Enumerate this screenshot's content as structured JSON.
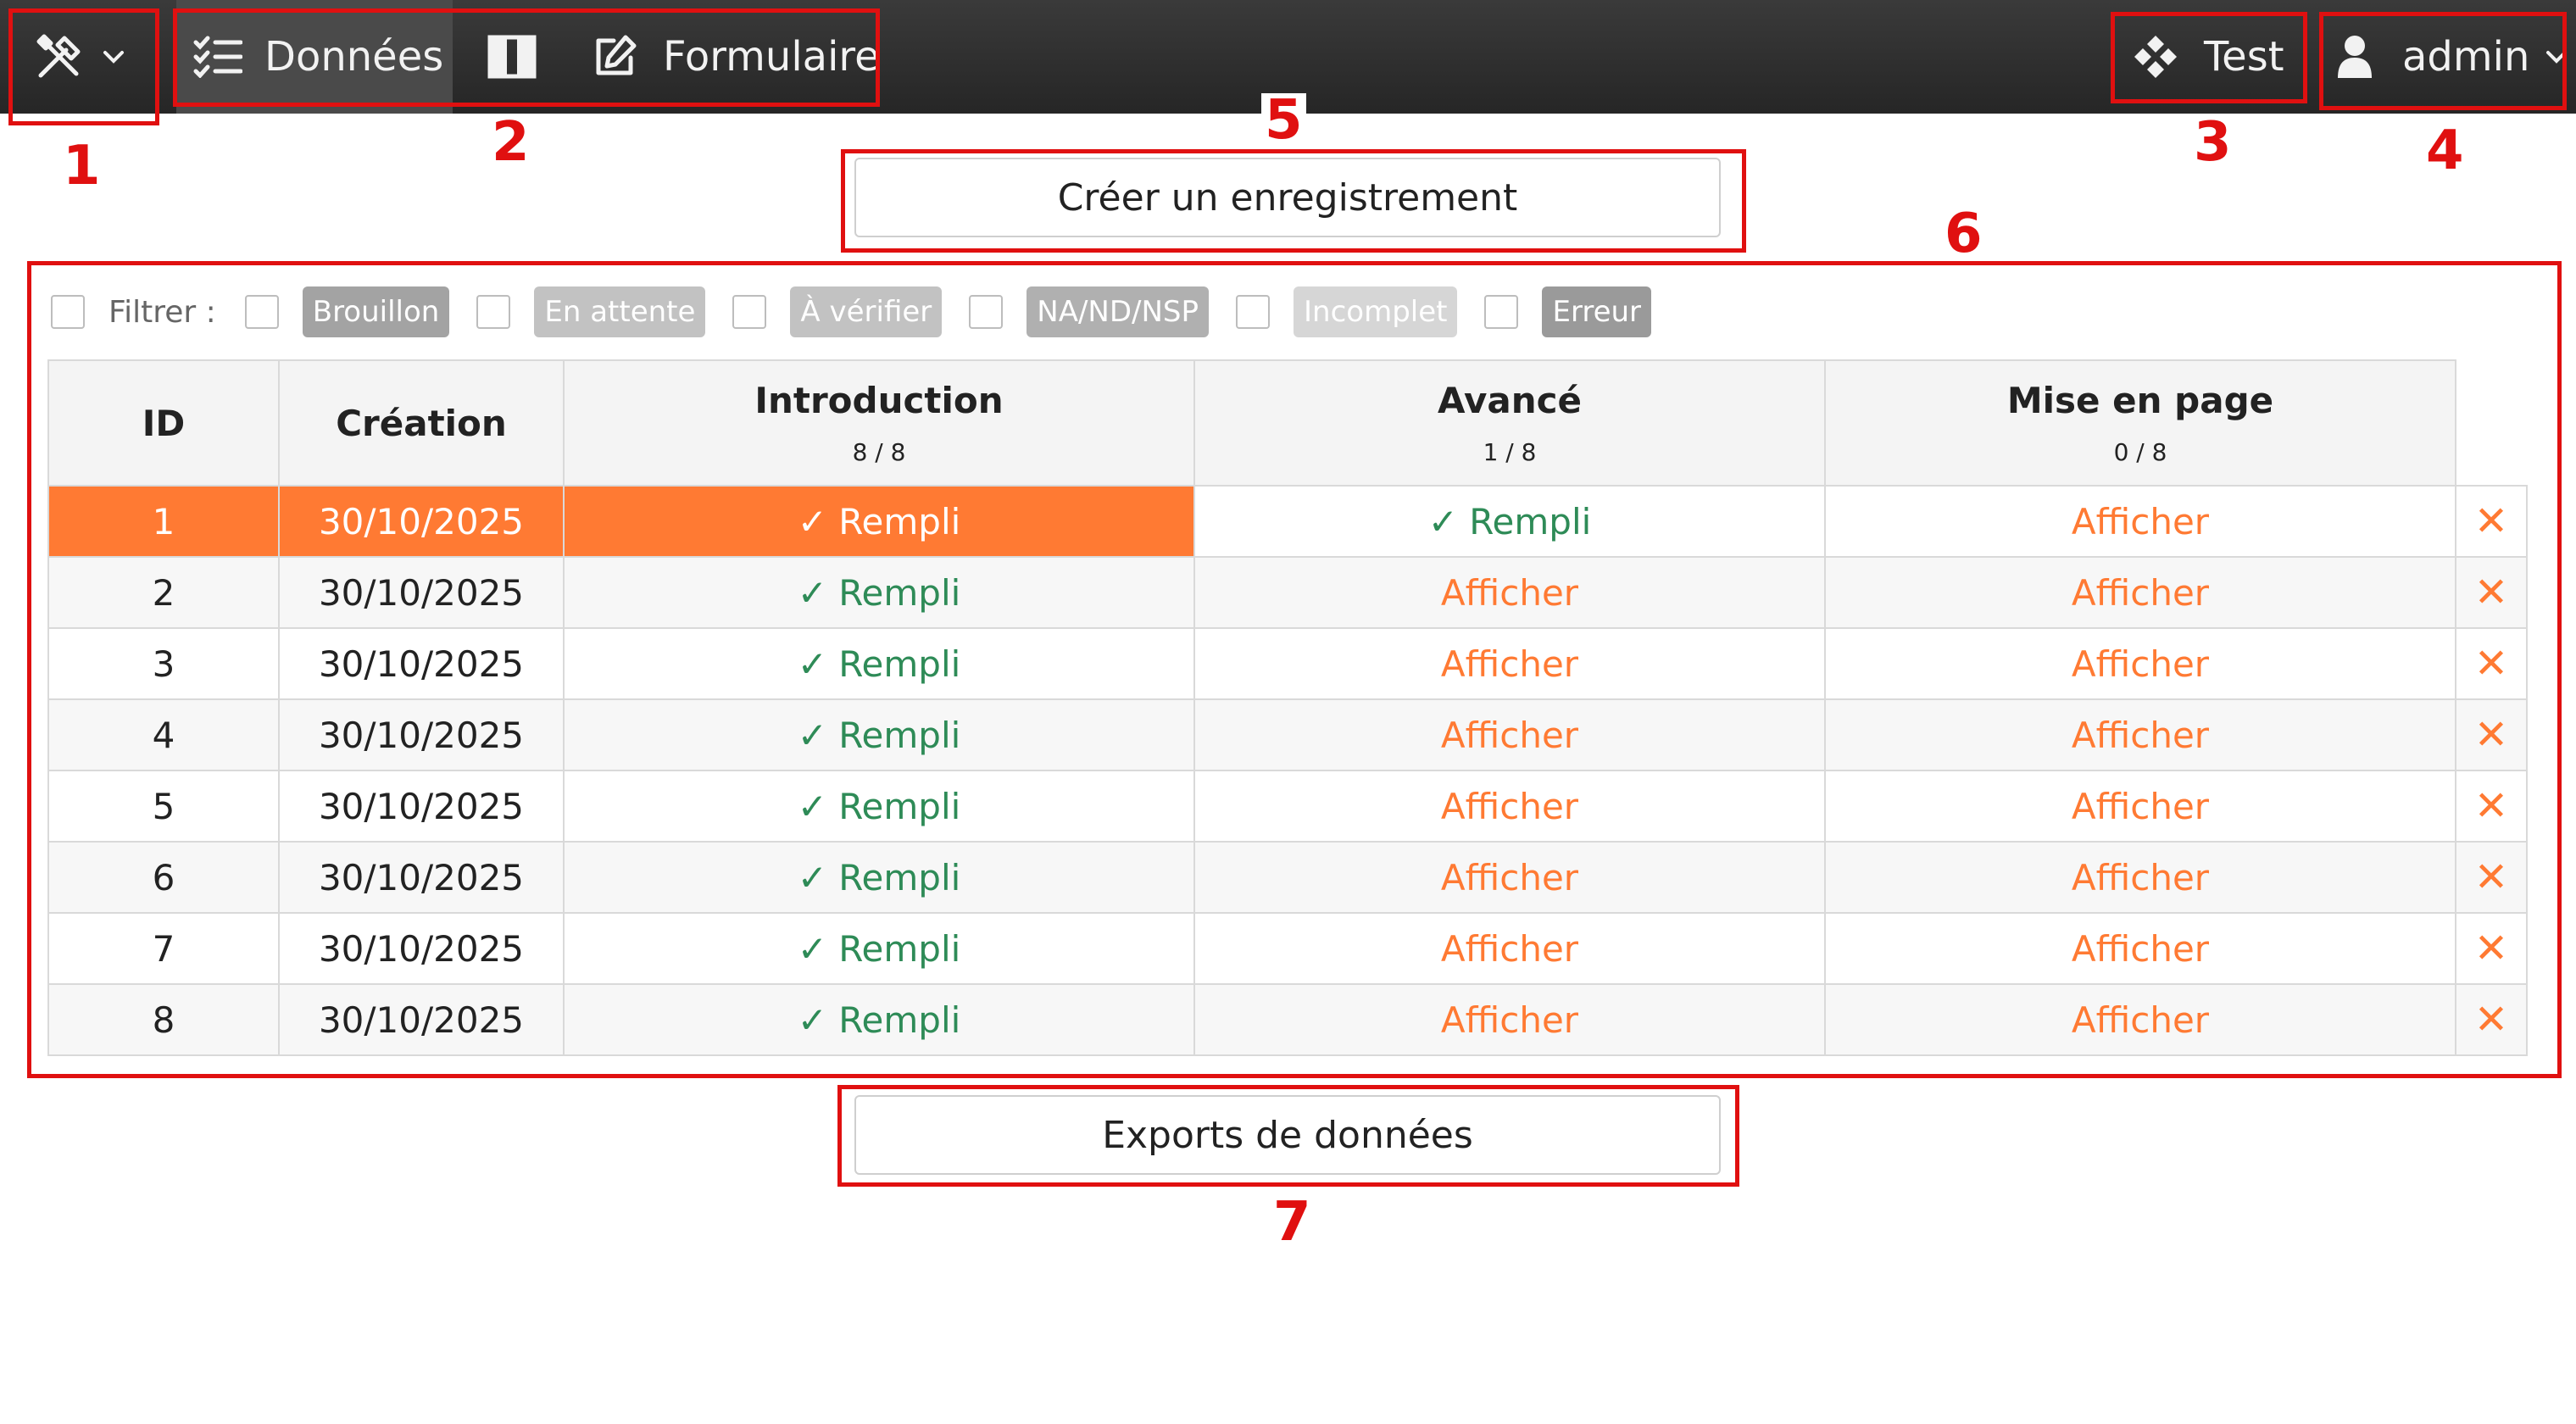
{
  "topbar": {
    "tools_icon": "tools-icon",
    "tabs": [
      {
        "label": "Données",
        "icon": "list-check-icon",
        "active": true
      },
      {
        "label": "",
        "icon": "columns-icon",
        "active": false
      },
      {
        "label": "Formulaire",
        "icon": "edit-icon",
        "active": false
      }
    ],
    "test_label": "Test",
    "test_icon": "diamond-grid-icon",
    "user_label": "admin",
    "user_icon": "user-icon"
  },
  "annotations": [
    "1",
    "2",
    "3",
    "4",
    "5",
    "6",
    "7"
  ],
  "create_button": "Créer un enregistrement",
  "export_button": "Exports de données",
  "filter": {
    "label": "Filtrer :",
    "chips": [
      {
        "label": "Brouillon",
        "color": "#a3a3a3"
      },
      {
        "label": "En attente",
        "color": "#c2c2c2"
      },
      {
        "label": "À vérifier",
        "color": "#c2c2c2"
      },
      {
        "label": "NA/ND/NSP",
        "color": "#b0b0b0"
      },
      {
        "label": "Incomplet",
        "color": "#d6d6d6"
      },
      {
        "label": "Erreur",
        "color": "#9a9a9a"
      }
    ]
  },
  "table": {
    "headers": [
      {
        "label": "ID",
        "sub": ""
      },
      {
        "label": "Création",
        "sub": ""
      },
      {
        "label": "Introduction",
        "sub": "8 / 8"
      },
      {
        "label": "Avancé",
        "sub": "1 / 8"
      },
      {
        "label": "Mise en page",
        "sub": "0 / 8"
      }
    ],
    "rows": [
      {
        "id": "1",
        "created": "30/10/2025",
        "intro": "✓ Rempli",
        "advanced": "✓ Rempli",
        "layout": "Afficher",
        "delete": "✕"
      },
      {
        "id": "2",
        "created": "30/10/2025",
        "intro": "✓ Rempli",
        "advanced": "Afficher",
        "layout": "Afficher",
        "delete": "✕"
      },
      {
        "id": "3",
        "created": "30/10/2025",
        "intro": "✓ Rempli",
        "advanced": "Afficher",
        "layout": "Afficher",
        "delete": "✕"
      },
      {
        "id": "4",
        "created": "30/10/2025",
        "intro": "✓ Rempli",
        "advanced": "Afficher",
        "layout": "Afficher",
        "delete": "✕"
      },
      {
        "id": "5",
        "created": "30/10/2025",
        "intro": "✓ Rempli",
        "advanced": "Afficher",
        "layout": "Afficher",
        "delete": "✕"
      },
      {
        "id": "6",
        "created": "30/10/2025",
        "intro": "✓ Rempli",
        "advanced": "Afficher",
        "layout": "Afficher",
        "delete": "✕"
      },
      {
        "id": "7",
        "created": "30/10/2025",
        "intro": "✓ Rempli",
        "advanced": "Afficher",
        "layout": "Afficher",
        "delete": "✕"
      },
      {
        "id": "8",
        "created": "30/10/2025",
        "intro": "✓ Rempli",
        "advanced": "Afficher",
        "layout": "Afficher",
        "delete": "✕"
      }
    ]
  },
  "colors": {
    "accent": "#ff7a33",
    "success": "#2e8b57",
    "annotation": "#e01010",
    "topbar": "#2e2e2e"
  }
}
